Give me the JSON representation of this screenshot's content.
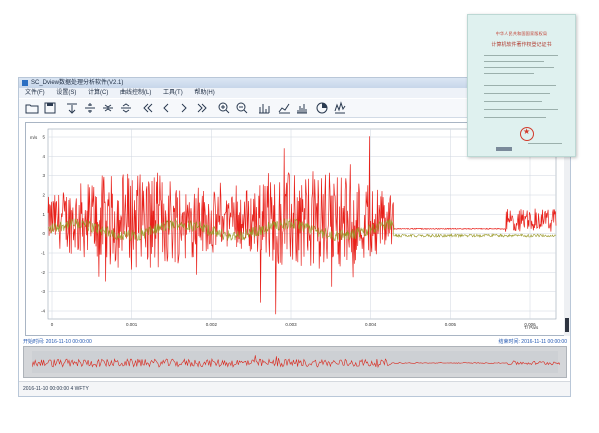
{
  "window": {
    "title": "SC_Dview数据处理分析软件(V2.1)",
    "menu": [
      "文件(F)",
      "设置(S)",
      "计算(C)",
      "曲线控制(L)",
      "工具(T)",
      "帮助(H)"
    ],
    "toolbar_icons": [
      "open-folder-icon",
      "save-icon",
      "align-top-icon",
      "align-middle-icon",
      "collapse-icon",
      "expand-icon",
      "first-icon",
      "prev-icon",
      "next-icon",
      "last-icon",
      "zoom-in-icon",
      "zoom-out-icon",
      "bar-chart-icon",
      "line-chart-icon",
      "spectrum-icon",
      "pie-chart-icon",
      "peak-icon"
    ]
  },
  "plot": {
    "y_ticks": [
      "5",
      "4",
      "3",
      "2",
      "1",
      "0",
      "-1",
      "-2",
      "-3",
      "-4"
    ],
    "x_ticks": [
      "0",
      "0.001",
      "0.002",
      "0.003",
      "0.004",
      "0.005",
      "0.006"
    ],
    "x_unit": "T/ Pa/s",
    "y_unit": "m/s"
  },
  "timebar": {
    "start": "开始时间: 2016-11-10 00:00:00",
    "end": "结束时间: 2016-11-11 00:00:00"
  },
  "status": {
    "text": "2016-11-10 00:00:00  4 WFTY"
  },
  "certificate": {
    "header": "中华人民共和国国家版权局",
    "title": "计算机软件著作权登记证书"
  },
  "colors": {
    "main_signal": "#e8201a",
    "secondary_signal": "#9a9a2a",
    "overview_signal": "#d8281d"
  }
}
